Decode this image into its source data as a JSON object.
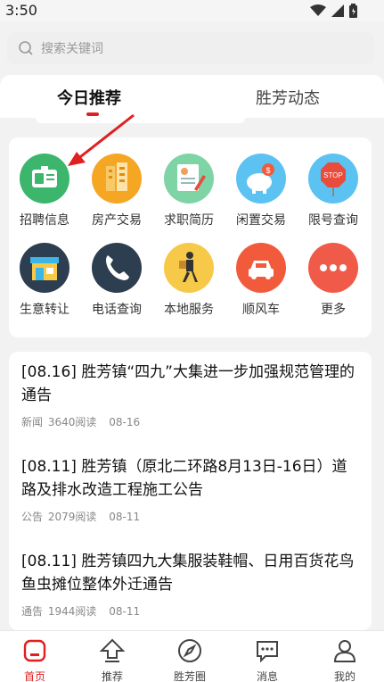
{
  "status_bar": {
    "time": "3:50"
  },
  "search": {
    "placeholder": "搜索关键词"
  },
  "tabs": [
    {
      "label": "今日推荐",
      "active": true
    },
    {
      "label": "胜芳动态",
      "active": false
    }
  ],
  "grid": [
    {
      "label": "招聘信息",
      "icon": "id-card-icon",
      "color": "#3cb66c"
    },
    {
      "label": "房产交易",
      "icon": "building-icon",
      "color": "#f5a623"
    },
    {
      "label": "求职简历",
      "icon": "resume-icon",
      "color": "#7fd4a6"
    },
    {
      "label": "闲置交易",
      "icon": "piggy-bank-icon",
      "color": "#5cc2f2"
    },
    {
      "label": "限号查询",
      "icon": "stop-sign-icon",
      "color": "#5cc2f2"
    },
    {
      "label": "生意转让",
      "icon": "shop-icon",
      "color": "#2d3e50"
    },
    {
      "label": "电话查询",
      "icon": "phone-icon",
      "color": "#2d3e50"
    },
    {
      "label": "本地服务",
      "icon": "courier-icon",
      "color": "#f7c948"
    },
    {
      "label": "顺风车",
      "icon": "car-icon",
      "color": "#f25a3c"
    },
    {
      "label": "更多",
      "icon": "more-icon",
      "color": "#f05a48"
    }
  ],
  "news": [
    {
      "title": "[08.16] 胜芳镇“四九”大集进一步加强规范管理的通告",
      "category": "新闻",
      "reads": "3640阅读",
      "date": "08-16"
    },
    {
      "title": "[08.11] 胜芳镇（原北二环路8月13日-16日）道路及排水改造工程施工公告",
      "category": "公告",
      "reads": "2079阅读",
      "date": "08-11"
    },
    {
      "title": "[08.11] 胜芳镇四九大集服装鞋帽、日用百货花鸟鱼虫摊位整体外迁通告",
      "category": "通告",
      "reads": "1944阅读",
      "date": "08-11"
    }
  ],
  "bottom_nav": [
    {
      "label": "首页",
      "icon": "home-icon",
      "active": true
    },
    {
      "label": "推荐",
      "icon": "upload-arrow-icon",
      "active": false
    },
    {
      "label": "胜芳圈",
      "icon": "compass-icon",
      "active": false
    },
    {
      "label": "消息",
      "icon": "message-icon",
      "active": false
    },
    {
      "label": "我的",
      "icon": "profile-icon",
      "active": false
    }
  ],
  "colors": {
    "accent": "#e02020",
    "arrow": "#e02020"
  }
}
